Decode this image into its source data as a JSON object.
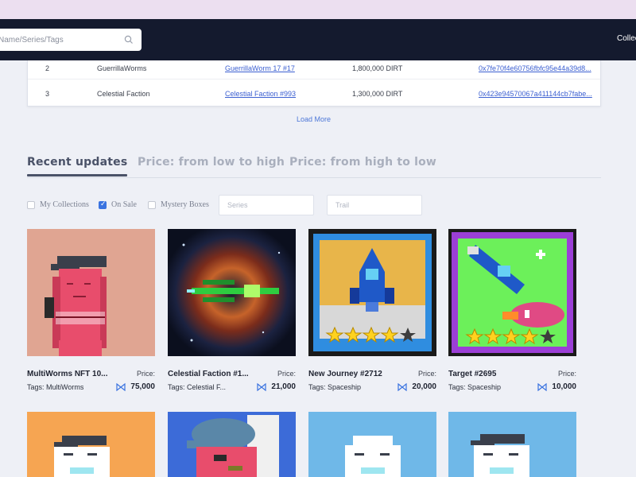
{
  "header": {
    "search_placeholder": "Name/Series/Tags",
    "right_link": "Collections"
  },
  "rank_table": {
    "rows": [
      {
        "rank": "2",
        "series": "GuerrillaWorms",
        "nft": "GuerrillaWorm 17 #17",
        "price": "1,800,000 DIRT",
        "address": "0x7fe70f4e60756fbfc95e44a39d8..."
      },
      {
        "rank": "3",
        "series": "Celestial Faction",
        "nft": "Celestial Faction #993",
        "price": "1,300,000 DIRT",
        "address": "0x423e94570067a411144cb7fabe..."
      }
    ],
    "load_more": "Load More"
  },
  "tabs": [
    {
      "label": "Recent updates",
      "active": true
    },
    {
      "label": "Price: from low to high",
      "active": false
    },
    {
      "label": "Price: from high to low",
      "active": false
    }
  ],
  "filters": {
    "my_collections": "My Collections",
    "on_sale": "On Sale",
    "mystery_boxes": "Mystery Boxes",
    "on_sale_checked": true,
    "series_placeholder": "Series",
    "trait_placeholder": "Trail"
  },
  "cards": [
    {
      "name": "MultiWorms NFT 10...",
      "price_label": "Price:",
      "tags": "Tags: MultiWorms",
      "price": "75,000",
      "art": "pink-worm-cap"
    },
    {
      "name": "Celestial Faction #1...",
      "price_label": "Price:",
      "tags": "Tags: Celestial F...",
      "price": "21,000",
      "art": "spaceship-nebula"
    },
    {
      "name": "New Journey #2712",
      "price_label": "Price:",
      "tags": "Tags: Spaceship",
      "price": "20,000",
      "art": "rocket-launch"
    },
    {
      "name": "Target #2695",
      "price_label": "Price:",
      "tags": "Tags: Spaceship",
      "price": "10,000",
      "art": "rocket-target"
    }
  ],
  "bottom_cards": [
    {
      "art": "white-worm-orange"
    },
    {
      "art": "pink-worm-beanie-blue"
    },
    {
      "art": "white-worm-skyblue"
    },
    {
      "art": "white-worm-cap-skyblue"
    }
  ],
  "colors": {
    "header_bg": "#141a2e",
    "accent_link": "#3b5fd1",
    "checkbox_checked": "#3a73e0",
    "active_tab": "#4a5268"
  },
  "icons": {
    "search": "search-icon",
    "price_token": "token-icon"
  }
}
